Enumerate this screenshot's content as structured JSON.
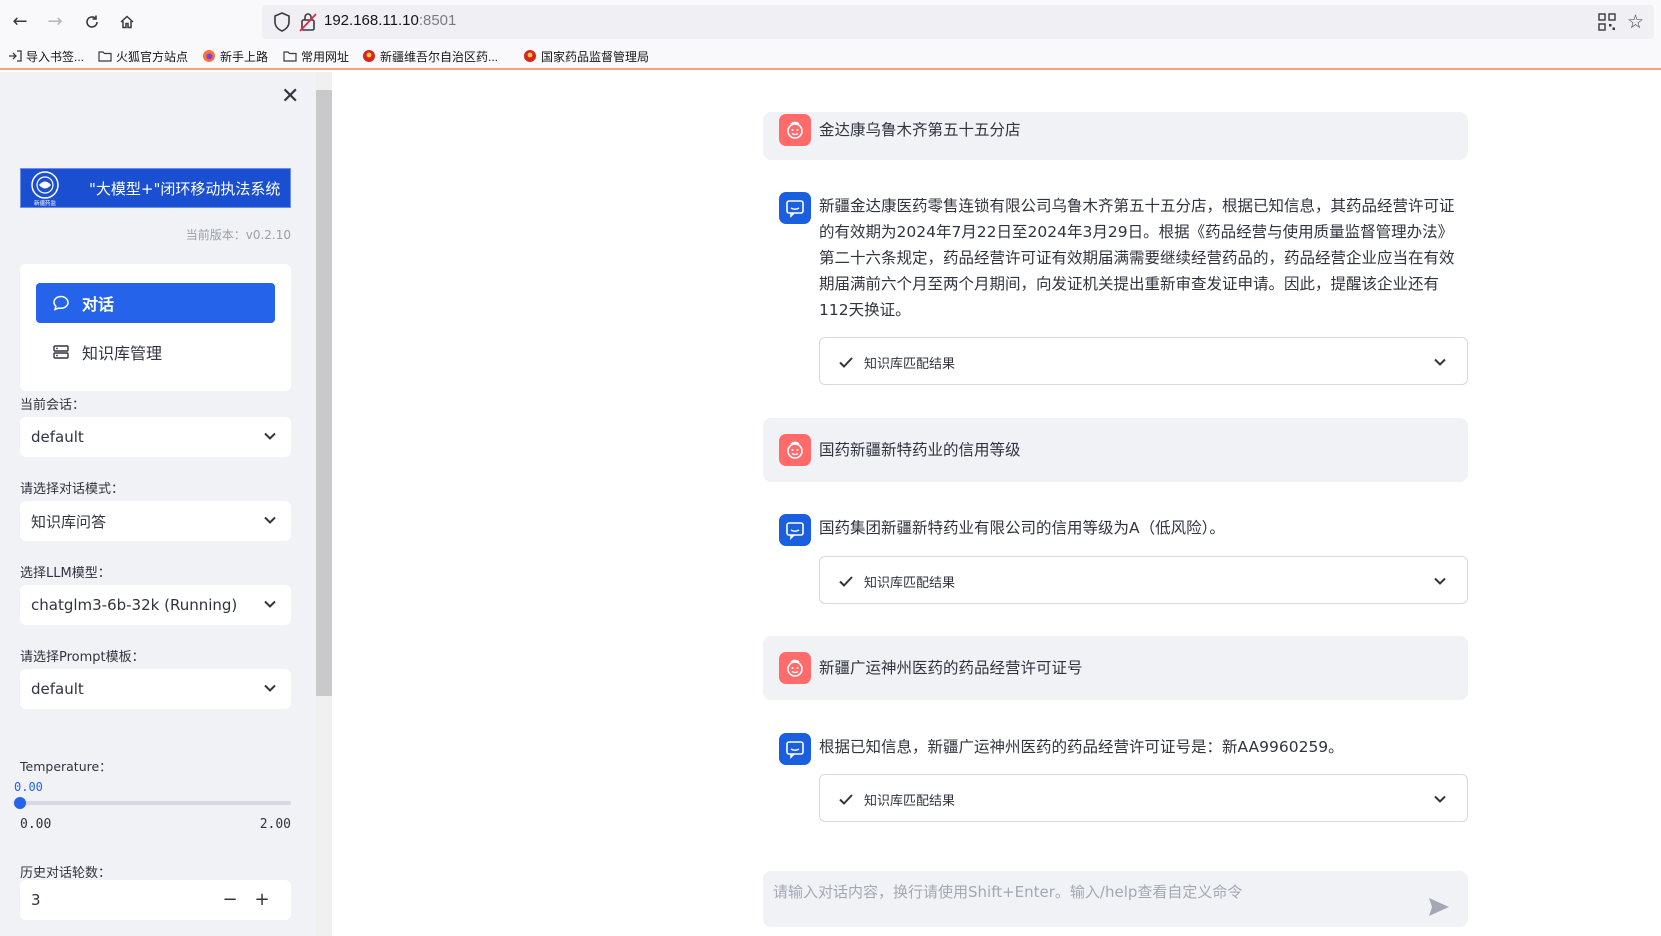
{
  "browser": {
    "url_host": "192.168.11.10",
    "url_port": ":8501",
    "bookmarks": [
      {
        "label": "导入书签..."
      },
      {
        "label": "火狐官方站点"
      },
      {
        "label": "新手上路"
      },
      {
        "label": "常用网址"
      },
      {
        "label": "新疆维吾尔自治区药..."
      },
      {
        "label": "国家药品监督管理局"
      }
    ]
  },
  "sidebar": {
    "logo_title": "\"大模型+\"闭环移动执法系统",
    "logo_emblem_text": "新疆药监",
    "version": "当前版本：v0.2.10",
    "menu": [
      {
        "label": "对话"
      },
      {
        "label": "知识库管理"
      }
    ],
    "session_label": "当前会话：",
    "session_value": "default",
    "mode_label": "请选择对话模式：",
    "mode_value": "知识库问答",
    "llm_label": "选择LLM模型：",
    "llm_value": "chatglm3-6b-32k (Running)",
    "prompt_label": "请选择Prompt模板：",
    "prompt_value": "default",
    "temperature_label": "Temperature：",
    "temperature_value": "0.00",
    "temperature_min": "0.00",
    "temperature_max": "2.00",
    "temperature_fraction": 0,
    "history_label": "历史对话轮数：",
    "history_value": "3",
    "minus": "−",
    "plus": "+"
  },
  "chat": {
    "messages": [
      {
        "role": "user",
        "text": "金达康乌鲁木齐第五十五分店"
      },
      {
        "role": "assistant",
        "text": "新疆金达康医药零售连锁有限公司乌鲁木齐第五十五分店，根据已知信息，其药品经营许可证的有效期为2024年7月22日至2024年3月29日。根据《药品经营与使用质量监督管理办法》第二十六条规定，药品经营许可证有效期届满需要继续经营药品的，药品经营企业应当在有效期届满前六个月至两个月期间，向发证机关提出重新审查发证申请。因此，提醒该企业还有112天换证。",
        "expander": "知识库匹配结果"
      },
      {
        "role": "user",
        "text": "国药新疆新特药业的信用等级"
      },
      {
        "role": "assistant",
        "text": "国药集团新疆新特药业有限公司的信用等级为A（低风险）。",
        "expander": "知识库匹配结果"
      },
      {
        "role": "user",
        "text": "新疆广运神州医药的药品经营许可证号"
      },
      {
        "role": "assistant",
        "text": "根据已知信息，新疆广运神州医药的药品经营许可证号是：新AA9960259。",
        "expander": "知识库匹配结果"
      }
    ],
    "input_placeholder": "请输入对话内容，换行请使用Shift+Enter。输入/help查看自定义命令"
  },
  "colors": {
    "accent": "#2563eb",
    "user_avatar": "#ff6b6b",
    "bot_avatar": "#1a5fe0",
    "sidebar_bg": "#f0f2f6"
  },
  "icons": {
    "back": "arrow-left-icon",
    "forward": "arrow-right-icon",
    "reload": "reload-icon",
    "home": "home-icon",
    "close": "close-icon",
    "chat": "chat-bubble-icon",
    "kb": "database-icon",
    "send": "send-icon",
    "check": "check-icon",
    "chevron": "chevron-down-icon"
  }
}
